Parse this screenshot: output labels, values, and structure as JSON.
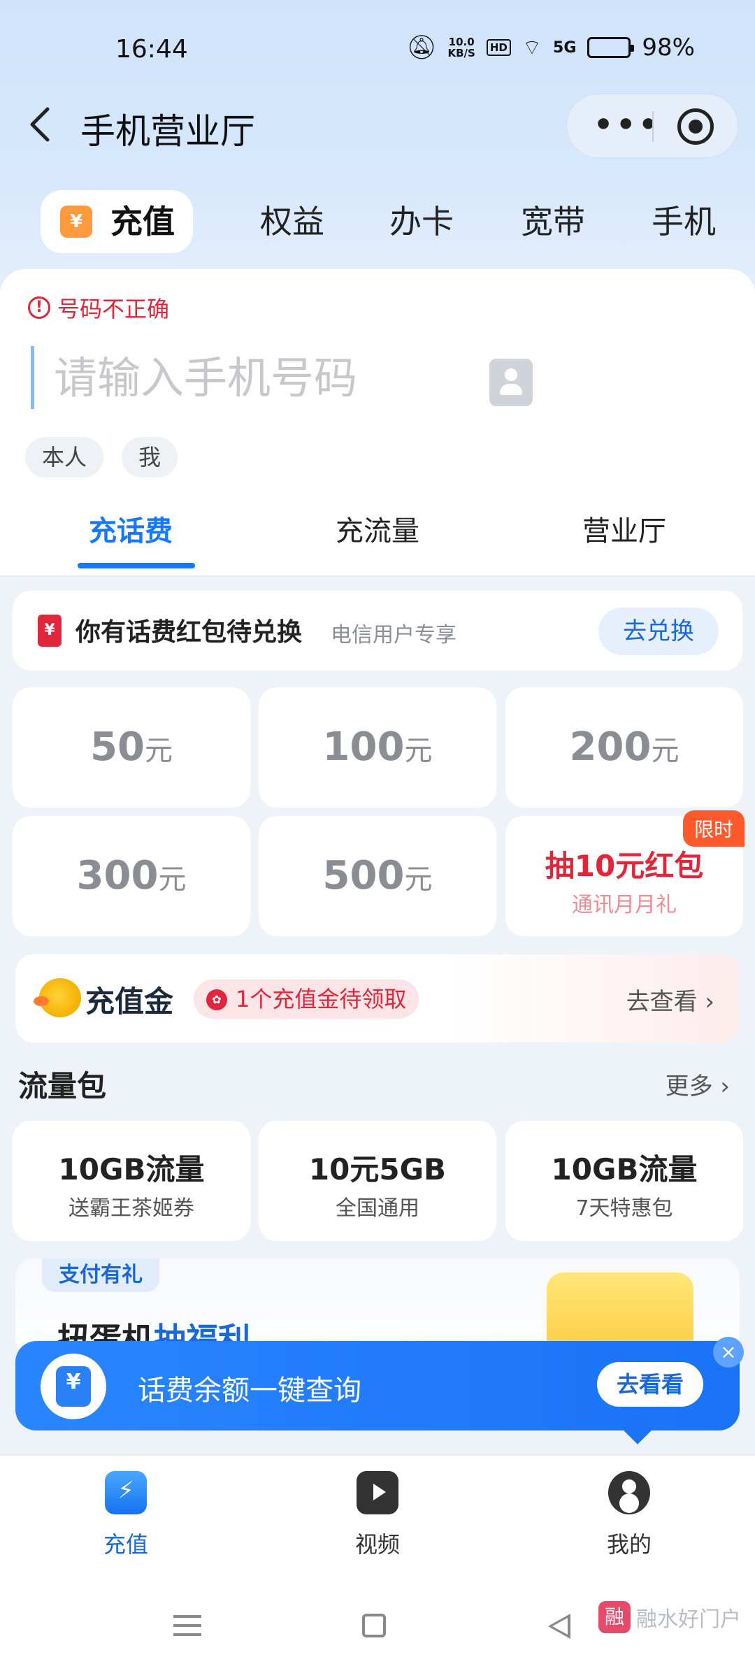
{
  "status": {
    "time": "16:44",
    "net_speed_value": "10.0",
    "net_speed_unit": "KB/S",
    "hd": "HD",
    "signal": "5G",
    "battery": "98%"
  },
  "header": {
    "title": "手机营业厅",
    "more": "•••"
  },
  "top_tabs": [
    {
      "label": "充值",
      "icon": "¥"
    },
    {
      "label": "权益"
    },
    {
      "label": "办卡"
    },
    {
      "label": "宽带"
    },
    {
      "label": "手机"
    }
  ],
  "form": {
    "error_icon": "!",
    "error_text": "号码不正确",
    "phone_placeholder": "请输入手机号码",
    "chips": [
      "本人",
      "我"
    ]
  },
  "sub_tabs": [
    "充话费",
    "充流量",
    "营业厅"
  ],
  "red_envelope": {
    "icon": "¥",
    "title": "你有话费红包待兑换",
    "subtitle": "电信用户专享",
    "button": "去兑换"
  },
  "amounts": [
    {
      "value": "50",
      "unit": "元"
    },
    {
      "value": "100",
      "unit": "元"
    },
    {
      "value": "200",
      "unit": "元"
    },
    {
      "value": "300",
      "unit": "元"
    },
    {
      "value": "500",
      "unit": "元"
    }
  ],
  "promo": {
    "tag": "限时",
    "title": "抽10元红包",
    "subtitle": "通讯月月礼"
  },
  "golden": {
    "brand": "充值金",
    "pill_icon": "✿",
    "pill_text": "1个充值金待领取",
    "link": "去查看 ›"
  },
  "data_packages": {
    "title": "流量包",
    "more": "更多 ›",
    "items": [
      {
        "name": "10GB流量",
        "desc": "送霸王茶姬券"
      },
      {
        "name": "10元5GB",
        "desc": "全国通用"
      },
      {
        "name": "10GB流量",
        "desc": "7天特惠包"
      }
    ]
  },
  "banner": {
    "badge": "支付有礼",
    "title_a": "扭蛋机",
    "title_b": "抽福利"
  },
  "query_bar": {
    "text": "话费余额一键查询",
    "button": "去看看",
    "close": "×"
  },
  "bottom_nav": [
    {
      "label": "充值",
      "icon": "charge-icon"
    },
    {
      "label": "视频",
      "icon": "video-icon"
    },
    {
      "label": "我的",
      "icon": "profile-icon"
    }
  ],
  "watermark": {
    "icon": "融",
    "text": "融水好门户"
  },
  "colors": {
    "accent": "#1677ff",
    "error": "#e0263a",
    "header_bg": "#cfe3fb"
  }
}
